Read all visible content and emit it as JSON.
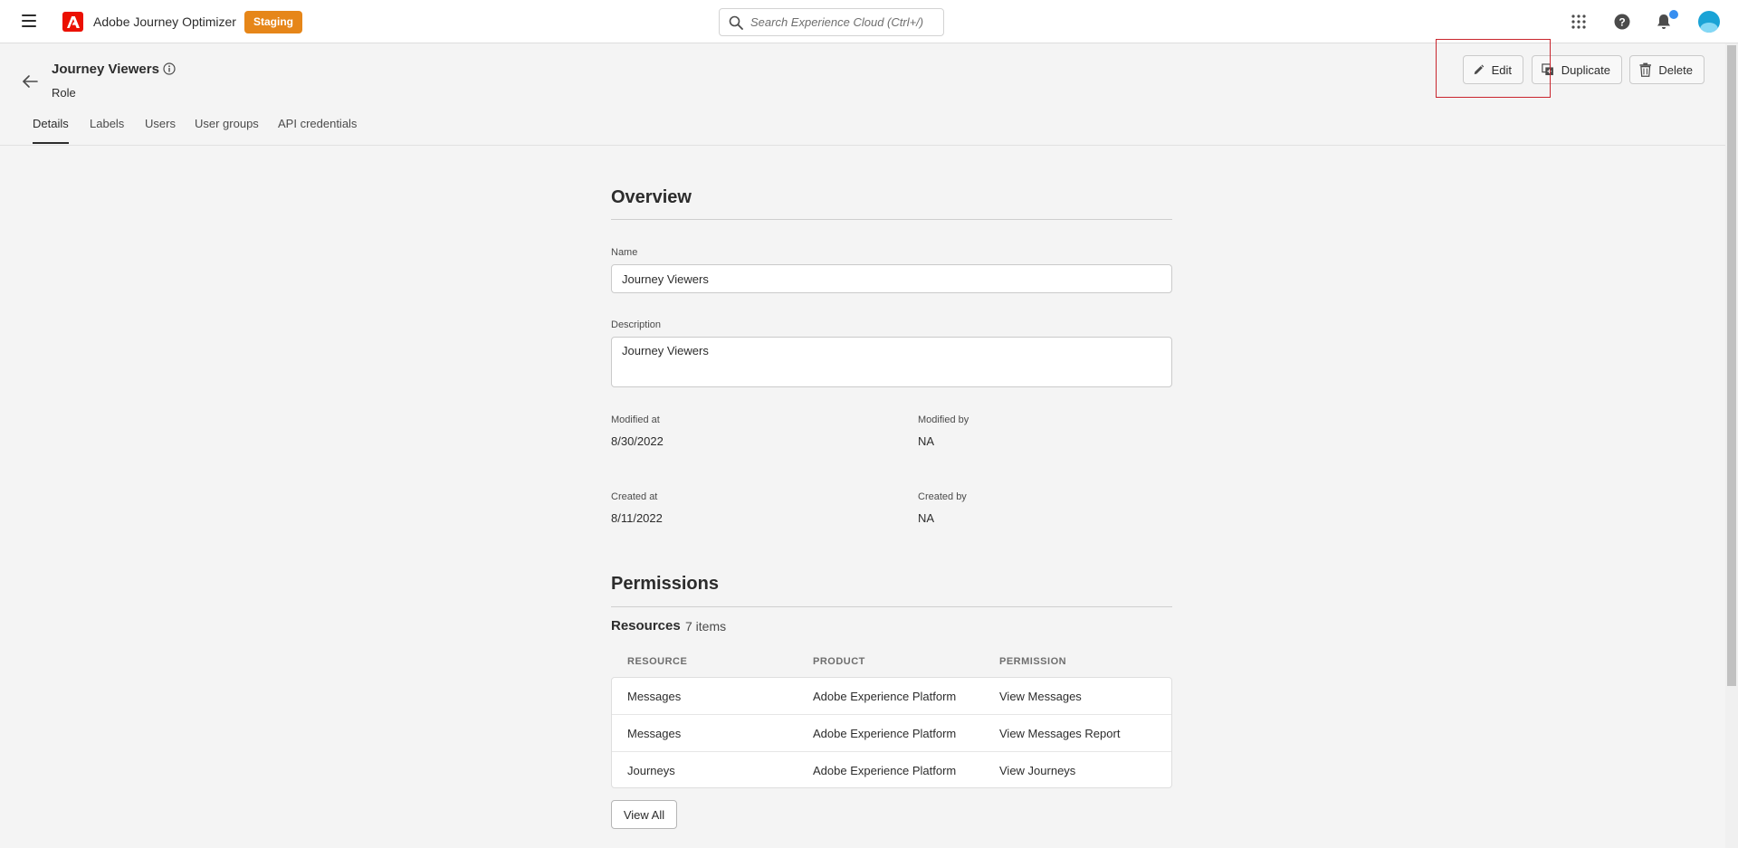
{
  "topbar": {
    "app_name": "Adobe Journey Optimizer",
    "env_badge": "Staging",
    "search_placeholder": "Search Experience Cloud (Ctrl+/)"
  },
  "header": {
    "title": "Journey Viewers",
    "subtitle": "Role",
    "actions": {
      "edit": "Edit",
      "duplicate": "Duplicate",
      "delete": "Delete"
    }
  },
  "tabs": [
    {
      "label": "Details",
      "active": true
    },
    {
      "label": "Labels",
      "active": false
    },
    {
      "label": "Users",
      "active": false
    },
    {
      "label": "User groups",
      "active": false
    },
    {
      "label": "API credentials",
      "active": false
    }
  ],
  "overview": {
    "title": "Overview",
    "name_label": "Name",
    "name_value": "Journey Viewers",
    "description_label": "Description",
    "description_value": "Journey Viewers",
    "modified_at_label": "Modified at",
    "modified_at_value": "8/30/2022",
    "modified_by_label": "Modified by",
    "modified_by_value": "NA",
    "created_at_label": "Created at",
    "created_at_value": "8/11/2022",
    "created_by_label": "Created by",
    "created_by_value": "NA"
  },
  "permissions": {
    "title": "Permissions",
    "resources_label": "Resources",
    "resources_count": "7 items",
    "columns": [
      "RESOURCE",
      "PRODUCT",
      "PERMISSION"
    ],
    "rows": [
      [
        "Messages",
        "Adobe Experience Platform",
        "View Messages"
      ],
      [
        "Messages",
        "Adobe Experience Platform",
        "View Messages Report"
      ],
      [
        "Journeys",
        "Adobe Experience Platform",
        "View Journeys"
      ]
    ],
    "view_all": "View All"
  },
  "colors": {
    "brand": "#eb1000",
    "badge": "#e68619",
    "highlight": "#c9252d",
    "notification": "#378ef0"
  },
  "icons": {
    "menu": "hamburger-icon",
    "search": "search-icon",
    "apps": "apps-grid-icon",
    "help": "help-icon",
    "notifications": "bell-icon",
    "back": "arrow-left-icon",
    "info": "info-icon",
    "edit": "pencil-icon",
    "duplicate": "duplicate-icon",
    "delete": "trash-icon"
  }
}
